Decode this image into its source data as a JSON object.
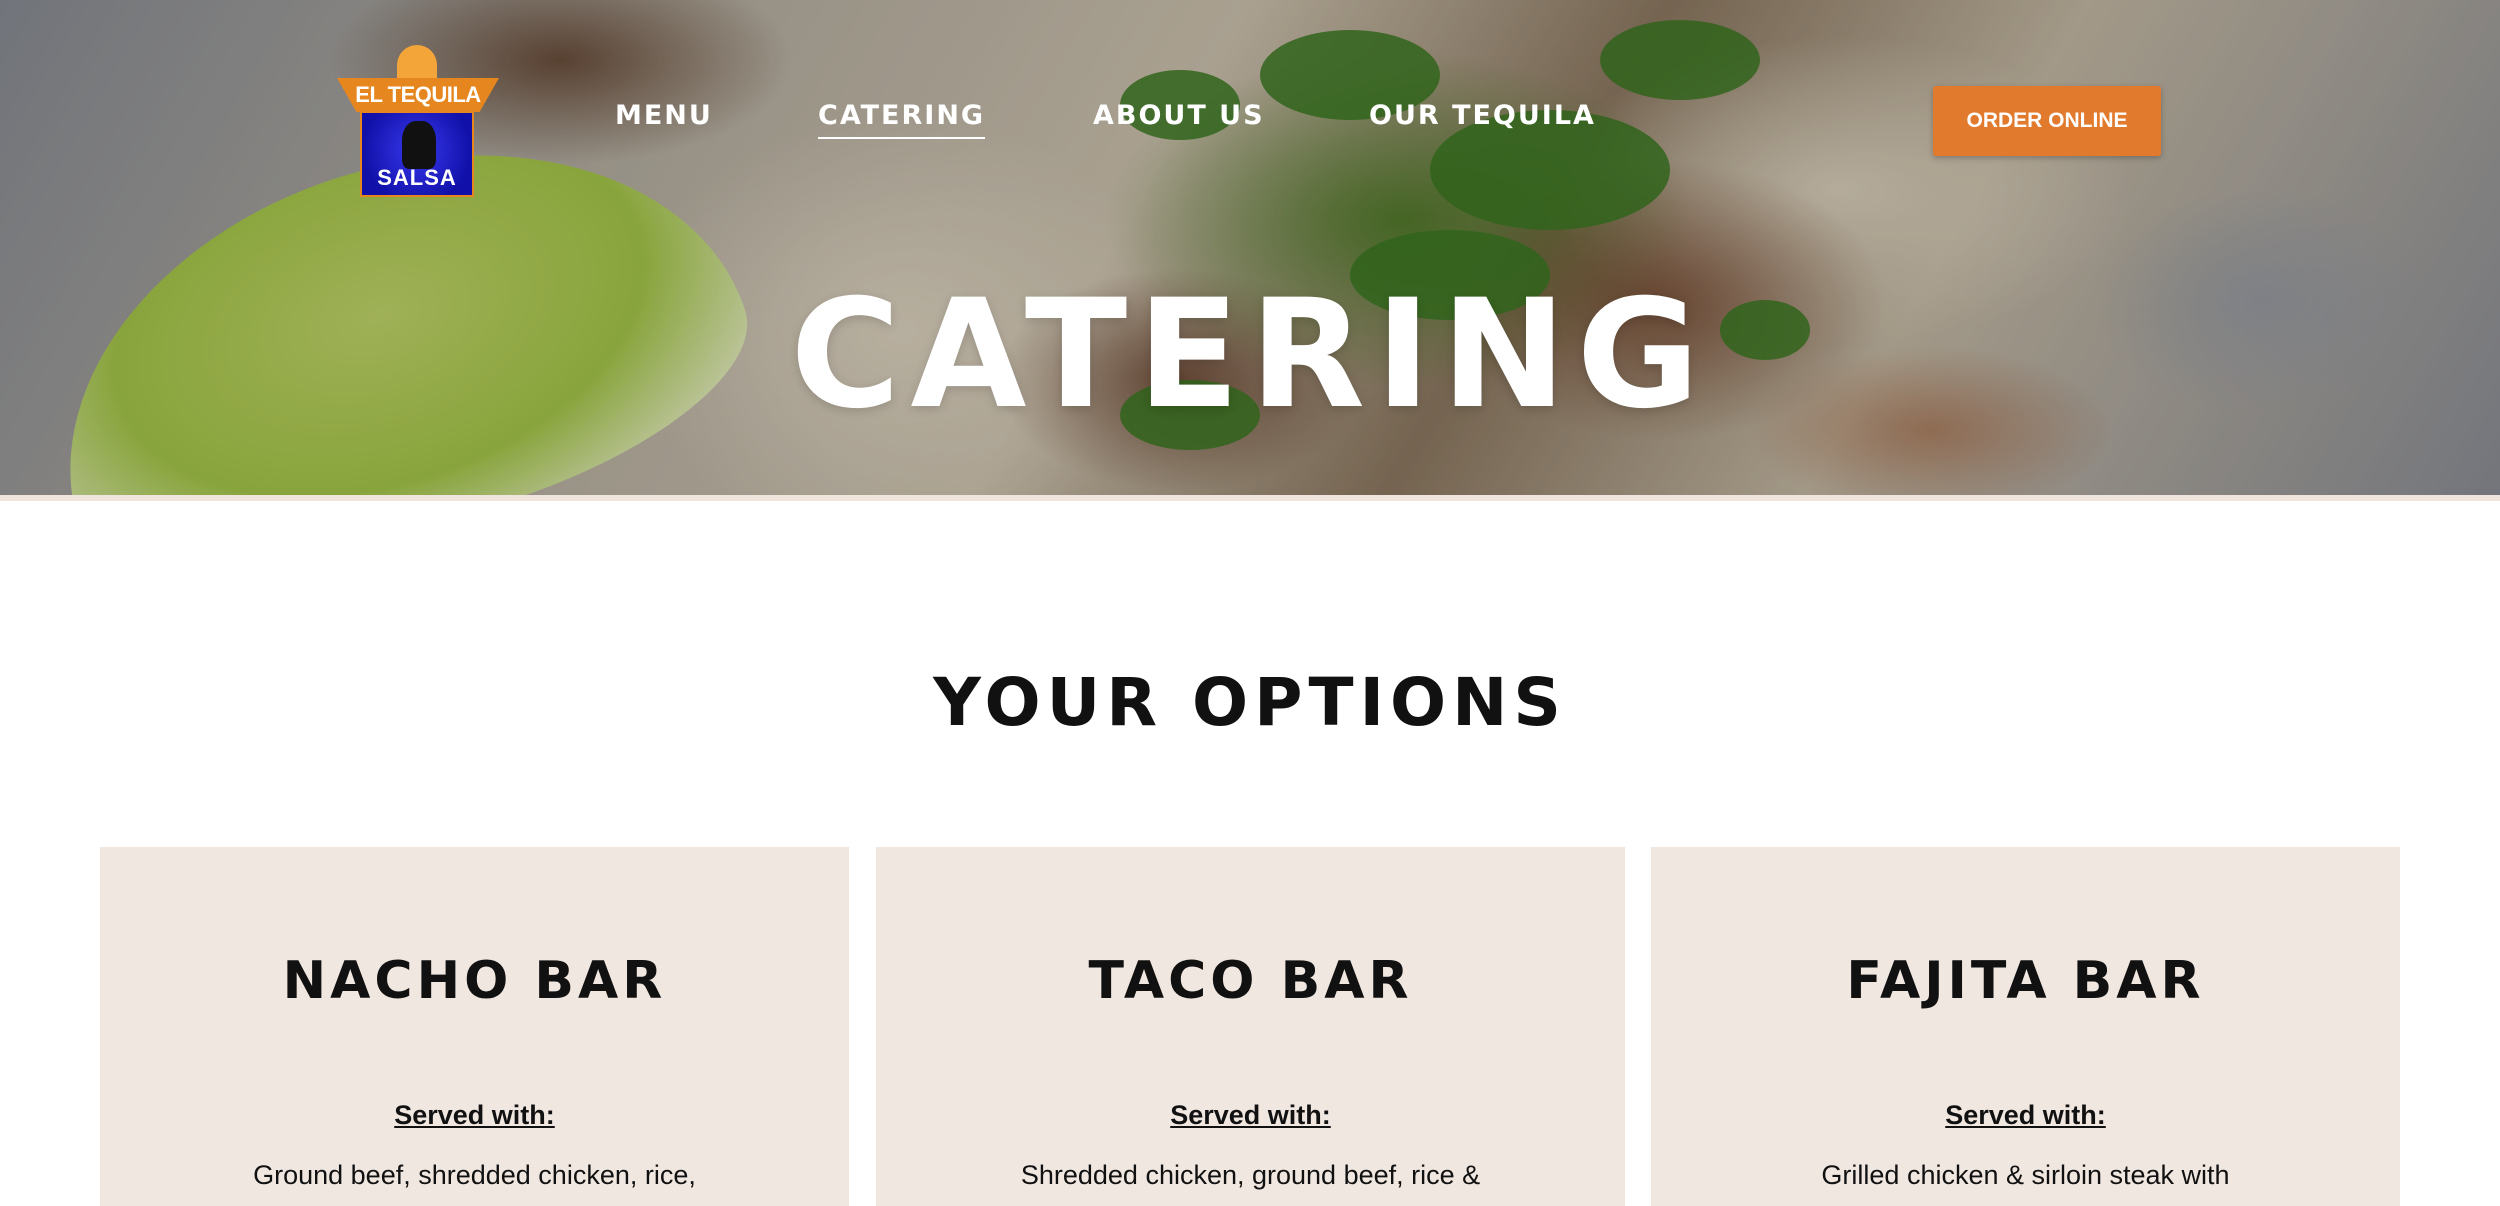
{
  "logo": {
    "top_text": "EL TEQUILA",
    "bottom_text": "SALSA"
  },
  "nav": {
    "items": [
      {
        "label": "MENU"
      },
      {
        "label": "CATERING",
        "active": true
      },
      {
        "label": "ABOUT US"
      },
      {
        "label": "OUR TEQUILA"
      }
    ],
    "order_button": "ORDER ONLINE"
  },
  "hero": {
    "title": "CATERING"
  },
  "options": {
    "title": "YOUR OPTIONS",
    "cards": [
      {
        "title": "NACHO BAR",
        "served_label": "Served with:",
        "description": "Ground beef, shredded chicken, rice,"
      },
      {
        "title": "TACO BAR",
        "served_label": "Served with:",
        "description": "Shredded chicken, ground beef, rice &"
      },
      {
        "title": "FAJITA BAR",
        "served_label": "Served with:",
        "description": "Grilled chicken & sirloin steak with"
      }
    ]
  },
  "colors": {
    "accent": "#e27a2e",
    "card_background": "#f1e7e1"
  }
}
